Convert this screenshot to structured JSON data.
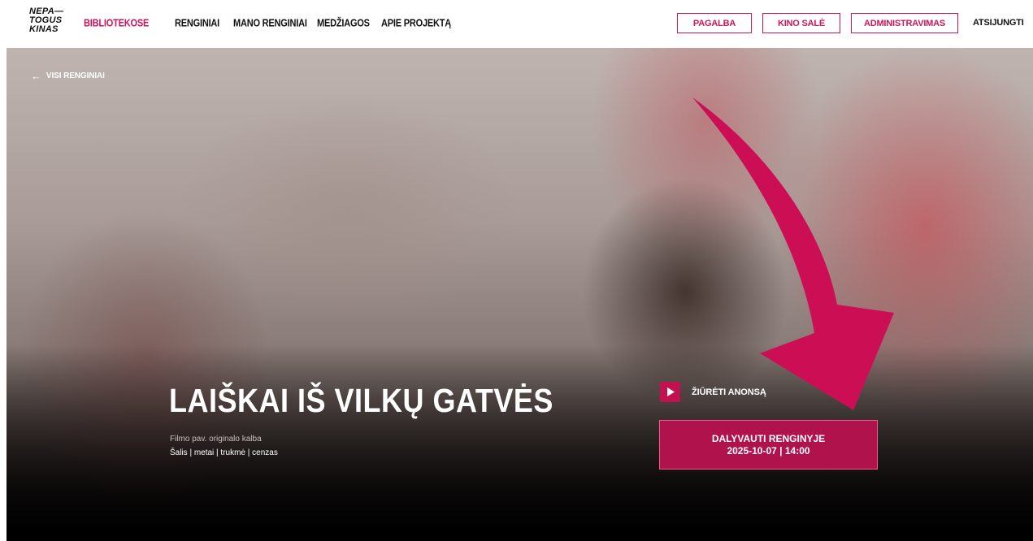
{
  "logo": {
    "lines": [
      "NEPA—",
      "TOGUS",
      "KINAS"
    ]
  },
  "nav": {
    "items": [
      {
        "label": "BIBLIOTEKOSE",
        "active": true
      },
      {
        "label": "RENGINIAI",
        "active": false
      },
      {
        "label": "MANO RENGINIAI",
        "active": false
      },
      {
        "label": "MEDŽIAGOS",
        "active": false
      },
      {
        "label": "APIE PROJEKTĄ",
        "active": false
      }
    ]
  },
  "header_buttons": {
    "help": "PAGALBA",
    "cinema_hall": "KINO SALĖ",
    "admin": "ADMINISTRAVIMAS",
    "logout": "ATSIJUNGTI"
  },
  "hero": {
    "back_label": "VISI RENGINIAI",
    "title": "LAIŠKAI IŠ VILKŲ GATVĖS",
    "original_title": "Filmo pav. originalo kalba",
    "meta": "Šalis | metai | trukmė | cenzas",
    "trailer_label": "ŽIŪRĖTI ANONSĄ",
    "join_label": "DALYVAUTI RENGINYJE",
    "join_datetime": "2025-10-07 | 14:00"
  },
  "colors": {
    "accent": "#d4145a",
    "button_fill": "#b0124c",
    "annotation_arrow": "#cc0f55"
  },
  "icons": {
    "back": "arrow-left-icon",
    "play": "play-icon",
    "annotation": "curved-arrow-icon"
  }
}
